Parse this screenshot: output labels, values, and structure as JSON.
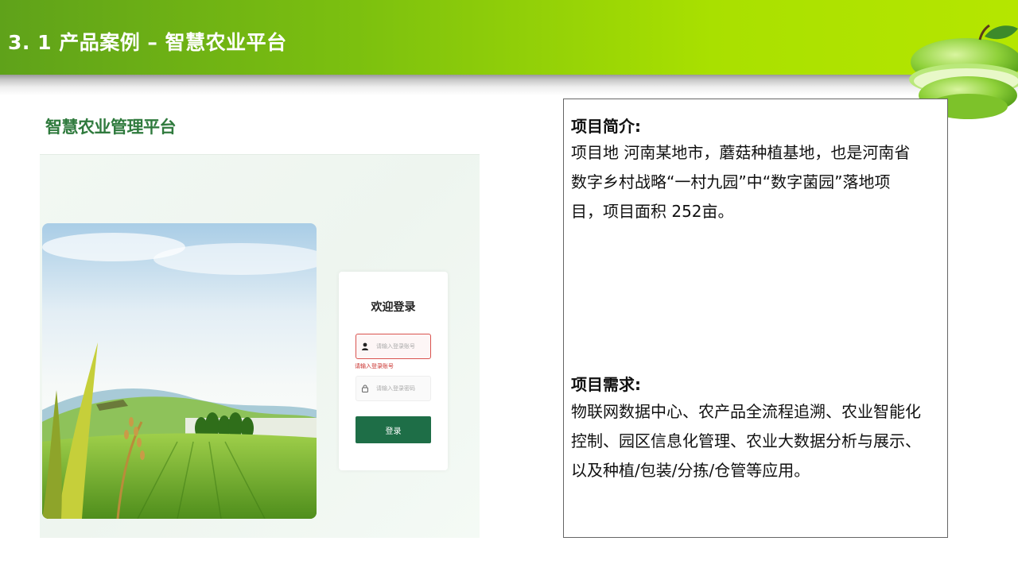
{
  "header": {
    "title": "3. 1 产品案例 – 智慧农业平台"
  },
  "screenshot": {
    "title": "智慧农业管理平台",
    "login": {
      "title": "欢迎登录",
      "username_placeholder": "请输入登录账号",
      "username_error": "请输入登录账号",
      "password_placeholder": "请输入登录密码",
      "button_label": "登录"
    }
  },
  "project": {
    "intro_heading": "项目简介:",
    "intro_lines": [
      "项目地  河南某地市，蘑菇种植基地，也是河南省",
      "数字乡村战略“一村九园”中“数字菌园”落地项",
      "目，项目面积 252亩。"
    ],
    "needs_heading": "项目需求:",
    "needs_lines": [
      "物联网数据中心、农产品全流程追溯、农业智能化",
      "控制、园区信息化管理、农业大数据分析与展示、",
      "以及种植/包装/分拣/仓管等应用。"
    ]
  },
  "colors": {
    "header_green": "#7cc00f",
    "title_green": "#2f7a3d",
    "button_green": "#1e6e47",
    "error_red": "#d9534f"
  },
  "icons": [
    "apple-decoration-icon",
    "user-icon",
    "lock-icon"
  ]
}
